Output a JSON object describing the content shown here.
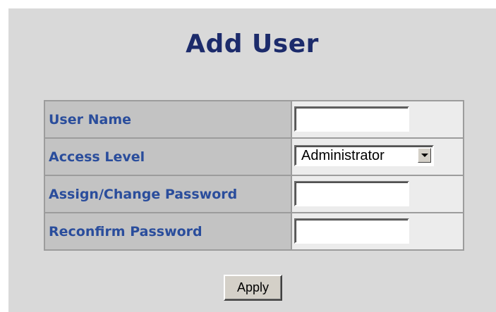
{
  "page": {
    "title": "Add User",
    "title_color": "#1c2b6b",
    "label_color": "#2a4d9c",
    "background": "#d9d9d9"
  },
  "form": {
    "user_name": {
      "label": "User Name",
      "value": ""
    },
    "access_level": {
      "label": "Access Level",
      "selected": "Administrator",
      "icon": "chevron-down-icon"
    },
    "password": {
      "label": "Assign/Change Password",
      "value": ""
    },
    "reconfirm": {
      "label": "Reconfirm Password",
      "value": ""
    }
  },
  "actions": {
    "apply_label": "Apply"
  }
}
